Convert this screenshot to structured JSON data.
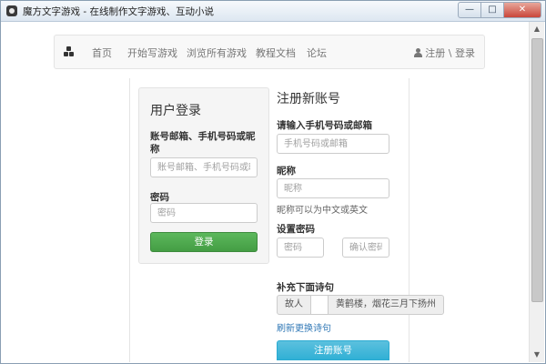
{
  "window": {
    "title": "魔方文字游戏 - 在线制作文字游戏、互动小说",
    "minimize_glyph": "—",
    "maximize_glyph": "□",
    "close_glyph": "✕"
  },
  "nav": {
    "logo_icon": "cube-logo-icon",
    "items": [
      {
        "label": "首页"
      },
      {
        "label": "开始写游戏"
      },
      {
        "label": "浏览所有游戏"
      },
      {
        "label": "教程文档"
      },
      {
        "label": "论坛"
      }
    ],
    "user_link": "注册 \\ 登录"
  },
  "login": {
    "title": "用户登录",
    "account_label": "账号邮箱、手机号码或昵称",
    "account_placeholder": "账号邮箱、手机号码或昵称",
    "password_label": "密码",
    "password_placeholder": "密码",
    "submit_label": "登录"
  },
  "register": {
    "title": "注册新账号",
    "contact_label": "请输入手机号码或邮箱",
    "contact_placeholder": "手机号码或邮箱",
    "nickname_label": "昵称",
    "nickname_placeholder": "昵称",
    "nickname_help": "昵称可以为中文或英文",
    "password_label": "设置密码",
    "password_placeholder": "密码",
    "confirm_placeholder": "确认密码",
    "poem_label": "补充下面诗句",
    "poem_prefix": "故人",
    "poem_suffix": "黄鹤楼，烟花三月下扬州",
    "refresh_link": "刷新更换诗句",
    "submit_label": "注册账号"
  },
  "colors": {
    "login_button": "#5cb85c",
    "register_button": "#5bc0de",
    "link": "#337ab7"
  }
}
